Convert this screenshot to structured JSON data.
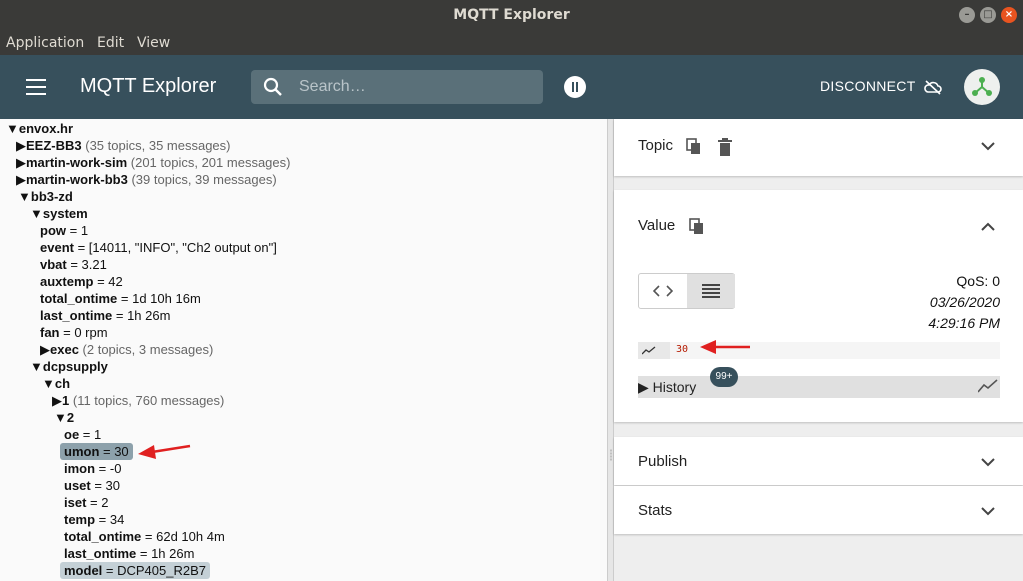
{
  "window": {
    "title": "MQTT Explorer"
  },
  "menu": {
    "items": [
      "Application",
      "Edit",
      "View"
    ]
  },
  "appbar": {
    "title": "MQTT Explorer",
    "search_placeholder": "Search…",
    "disconnect_label": "DISCONNECT"
  },
  "tree": {
    "nodes": [
      {
        "arrow": "▼",
        "key": "envox.hr",
        "value": "",
        "meta": ""
      },
      {
        "arrow": "▶",
        "key": "EEZ-BB3",
        "value": "",
        "meta": "(35 topics, 35 messages)"
      },
      {
        "arrow": "▶",
        "key": "martin-work-sim",
        "value": "",
        "meta": "(201 topics, 201 messages)"
      },
      {
        "arrow": "▶",
        "key": "martin-work-bb3",
        "value": "",
        "meta": "(39 topics, 39 messages)"
      },
      {
        "arrow": "▼",
        "key": "bb3-zd",
        "value": "",
        "meta": ""
      },
      {
        "arrow": "▼",
        "key": "system",
        "value": "",
        "meta": ""
      },
      {
        "arrow": "",
        "key": "pow",
        "value": " = 1",
        "meta": ""
      },
      {
        "arrow": "",
        "key": "event",
        "value": " = [14011, \"INFO\", \"Ch2 output on\"]",
        "meta": ""
      },
      {
        "arrow": "",
        "key": "vbat",
        "value": " = 3.21",
        "meta": ""
      },
      {
        "arrow": "",
        "key": "auxtemp",
        "value": " = 42",
        "meta": ""
      },
      {
        "arrow": "",
        "key": "total_ontime",
        "value": " = 1d 10h 16m",
        "meta": ""
      },
      {
        "arrow": "",
        "key": "last_ontime",
        "value": " = 1h 26m",
        "meta": ""
      },
      {
        "arrow": "",
        "key": "fan",
        "value": " = 0 rpm",
        "meta": ""
      },
      {
        "arrow": "▶",
        "key": "exec",
        "value": "",
        "meta": "(2 topics, 3 messages)"
      },
      {
        "arrow": "▼",
        "key": "dcpsupply",
        "value": "",
        "meta": ""
      },
      {
        "arrow": "▼",
        "key": "ch",
        "value": "",
        "meta": ""
      },
      {
        "arrow": "▶",
        "key": "1",
        "value": "",
        "meta": "(11 topics, 760 messages)"
      },
      {
        "arrow": "▼",
        "key": "2",
        "value": "",
        "meta": ""
      },
      {
        "arrow": "",
        "key": "oe",
        "value": " = 1",
        "meta": ""
      },
      {
        "arrow": "",
        "key": "umon",
        "value": " = 30",
        "meta": ""
      },
      {
        "arrow": "",
        "key": "imon",
        "value": " = -0",
        "meta": ""
      },
      {
        "arrow": "",
        "key": "uset",
        "value": " = 30",
        "meta": ""
      },
      {
        "arrow": "",
        "key": "iset",
        "value": " = 2",
        "meta": ""
      },
      {
        "arrow": "",
        "key": "temp",
        "value": " = 34",
        "meta": ""
      },
      {
        "arrow": "",
        "key": "total_ontime",
        "value": " = 62d 10h 4m",
        "meta": ""
      },
      {
        "arrow": "",
        "key": "last_ontime",
        "value": " = 1h 26m",
        "meta": ""
      },
      {
        "arrow": "",
        "key": "model",
        "value": " = DCP405_R2B7",
        "meta": ""
      }
    ]
  },
  "panel": {
    "topic_label": "Topic",
    "value_label": "Value",
    "qos": "QoS: 0",
    "date": "03/26/2020",
    "time": "4:29:16 PM",
    "value": "30",
    "history_label": "▶ History",
    "history_badge": "99+",
    "publish_label": "Publish",
    "stats_label": "Stats"
  },
  "colors": {
    "appbar": "#37505c",
    "highlight": "#8da1ab",
    "annotation_arrow": "#e02020"
  }
}
